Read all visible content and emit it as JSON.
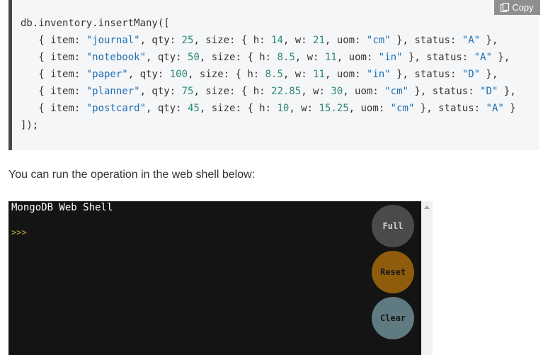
{
  "code": {
    "lines": [
      [
        {
          "t": "db.inventory.insertMany(["
        }
      ],
      [
        {
          "t": "   { item: "
        },
        {
          "t": "\"journal\"",
          "k": "s"
        },
        {
          "t": ", qty: "
        },
        {
          "t": "25",
          "k": "n"
        },
        {
          "t": ", size: { h: "
        },
        {
          "t": "14",
          "k": "n"
        },
        {
          "t": ", w: "
        },
        {
          "t": "21",
          "k": "n"
        },
        {
          "t": ", uom: "
        },
        {
          "t": "\"cm\"",
          "k": "s"
        },
        {
          "t": " }, status: "
        },
        {
          "t": "\"A\"",
          "k": "s"
        },
        {
          "t": " },"
        }
      ],
      [
        {
          "t": "   { item: "
        },
        {
          "t": "\"notebook\"",
          "k": "s"
        },
        {
          "t": ", qty: "
        },
        {
          "t": "50",
          "k": "n"
        },
        {
          "t": ", size: { h: "
        },
        {
          "t": "8.5",
          "k": "n"
        },
        {
          "t": ", w: "
        },
        {
          "t": "11",
          "k": "n"
        },
        {
          "t": ", uom: "
        },
        {
          "t": "\"in\"",
          "k": "s"
        },
        {
          "t": " }, status: "
        },
        {
          "t": "\"A\"",
          "k": "s"
        },
        {
          "t": " },"
        }
      ],
      [
        {
          "t": "   { item: "
        },
        {
          "t": "\"paper\"",
          "k": "s"
        },
        {
          "t": ", qty: "
        },
        {
          "t": "100",
          "k": "n"
        },
        {
          "t": ", size: { h: "
        },
        {
          "t": "8.5",
          "k": "n"
        },
        {
          "t": ", w: "
        },
        {
          "t": "11",
          "k": "n"
        },
        {
          "t": ", uom: "
        },
        {
          "t": "\"in\"",
          "k": "s"
        },
        {
          "t": " }, status: "
        },
        {
          "t": "\"D\"",
          "k": "s"
        },
        {
          "t": " },"
        }
      ],
      [
        {
          "t": "   { item: "
        },
        {
          "t": "\"planner\"",
          "k": "s"
        },
        {
          "t": ", qty: "
        },
        {
          "t": "75",
          "k": "n"
        },
        {
          "t": ", size: { h: "
        },
        {
          "t": "22.85",
          "k": "n"
        },
        {
          "t": ", w: "
        },
        {
          "t": "30",
          "k": "n"
        },
        {
          "t": ", uom: "
        },
        {
          "t": "\"cm\"",
          "k": "s"
        },
        {
          "t": " }, status: "
        },
        {
          "t": "\"D\"",
          "k": "s"
        },
        {
          "t": " },"
        }
      ],
      [
        {
          "t": "   { item: "
        },
        {
          "t": "\"postcard\"",
          "k": "s"
        },
        {
          "t": ", qty: "
        },
        {
          "t": "45",
          "k": "n"
        },
        {
          "t": ", size: { h: "
        },
        {
          "t": "10",
          "k": "n"
        },
        {
          "t": ", w: "
        },
        {
          "t": "15.25",
          "k": "n"
        },
        {
          "t": ", uom: "
        },
        {
          "t": "\"cm\"",
          "k": "s"
        },
        {
          "t": " }, status: "
        },
        {
          "t": "\"A\"",
          "k": "s"
        },
        {
          "t": " }"
        }
      ],
      [
        {
          "t": "]);"
        }
      ]
    ],
    "copy_label": "Copy",
    "copy_icon": "copy-icon"
  },
  "description": "You can run the operation in the web shell below:",
  "shell": {
    "title": "MongoDB Web Shell",
    "prompt": ">>>",
    "buttons": {
      "full": "Full",
      "reset": "Reset",
      "clear": "Clear"
    }
  },
  "colors": {
    "string": "#1b6fb5",
    "number": "#2f8a73",
    "shell_bg": "#141414",
    "prompt": "#c9a545",
    "reset_button": "#8f5c0b",
    "clear_button": "#5f7a80",
    "full_button": "#4a4a4a"
  }
}
